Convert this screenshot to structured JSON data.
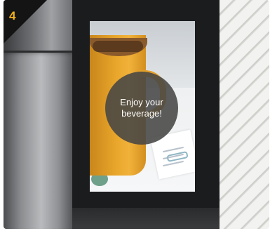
{
  "step": {
    "number": "4"
  },
  "screen": {
    "message": "Enjoy your beverage!"
  },
  "colors": {
    "step_number": "#f5b21c",
    "bezel": "#1b1c1e",
    "message_bg": "#464644"
  }
}
